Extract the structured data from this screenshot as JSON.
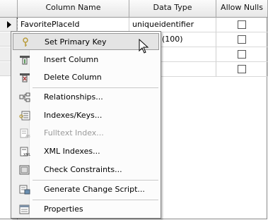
{
  "table": {
    "headers": {
      "column_name": "Column Name",
      "data_type": "Data Type",
      "allow_nulls": "Allow Nulls"
    },
    "rows": [
      {
        "column_name": "FavoritePlaceId",
        "data_type": "uniqueidentifier",
        "allow_nulls": false,
        "current": true
      },
      {
        "column_name": "",
        "data_type": "(100)",
        "allow_nulls": false,
        "current": false
      },
      {
        "column_name": "",
        "data_type": "",
        "allow_nulls": false,
        "current": false
      },
      {
        "column_name": "",
        "data_type": "",
        "allow_nulls": false,
        "current": false
      }
    ]
  },
  "context_menu": {
    "items": [
      {
        "label": "Set Primary Key",
        "icon": "key-icon",
        "selected": true,
        "enabled": true
      },
      {
        "label": "Insert Column",
        "icon": "insert-column-icon",
        "selected": false,
        "enabled": true
      },
      {
        "label": "Delete Column",
        "icon": "delete-column-icon",
        "selected": false,
        "enabled": true
      },
      {
        "label": "Relationships...",
        "icon": "relationships-icon",
        "selected": false,
        "enabled": true
      },
      {
        "label": "Indexes/Keys...",
        "icon": "indexes-keys-icon",
        "selected": false,
        "enabled": true
      },
      {
        "label": "Fulltext Index...",
        "icon": "fulltext-index-icon",
        "selected": false,
        "enabled": false
      },
      {
        "label": "XML Indexes...",
        "icon": "xml-indexes-icon",
        "selected": false,
        "enabled": true
      },
      {
        "label": "Check Constraints...",
        "icon": "check-constraints-icon",
        "selected": false,
        "enabled": true
      },
      {
        "label": "Generate Change Script...",
        "icon": "generate-script-icon",
        "selected": false,
        "enabled": true
      },
      {
        "label": "Properties",
        "icon": "properties-icon",
        "selected": false,
        "enabled": true
      }
    ]
  }
}
